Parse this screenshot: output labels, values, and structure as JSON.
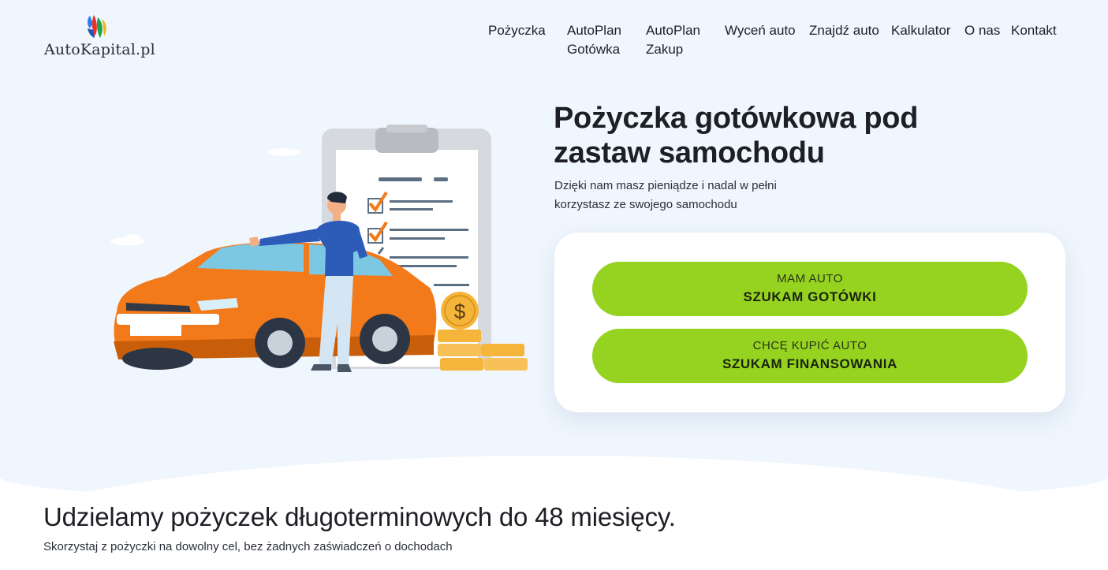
{
  "header": {
    "logo_text": "AutoKapital.pl",
    "nav": [
      {
        "line1": "Pożyczka",
        "line2": ""
      },
      {
        "line1": "AutoPlan",
        "line2": "Gotówka"
      },
      {
        "line1": "AutoPlan",
        "line2": "Zakup"
      },
      {
        "line1": "Wyceń auto",
        "line2": ""
      },
      {
        "line1": "Znajdź auto",
        "line2": ""
      },
      {
        "line1": "Kalkulator",
        "line2": ""
      },
      {
        "line1": "O nas",
        "line2": ""
      },
      {
        "line1": "Kontakt",
        "line2": ""
      }
    ]
  },
  "hero": {
    "title": "Pożyczka gotówkowa pod zastaw samochodu",
    "subtitle": "Dzięki nam masz pieniądze i nadal w pełni korzystasz ze swojego samochodu",
    "cta": [
      {
        "small": "MAM AUTO",
        "big": "SZUKAM GOTÓWKI"
      },
      {
        "small": "CHCĘ KUPIĆ AUTO",
        "big": "SZUKAM FINANSOWANIA"
      }
    ]
  },
  "illustration": {
    "coin_symbol": "$",
    "icons": [
      "car-icon",
      "person-icon",
      "clipboard-icon",
      "coin-icon"
    ]
  },
  "section": {
    "title": "Udzielamy pożyczek długoterminowych do 48 miesięcy.",
    "subtitle": "Skorzystaj z pożyczki na dowolny cel, bez żadnych zaświadczeń o dochodach"
  },
  "colors": {
    "accent_green": "#95d320",
    "hero_bg": "#eff6fe",
    "car_orange": "#f27a1a"
  }
}
